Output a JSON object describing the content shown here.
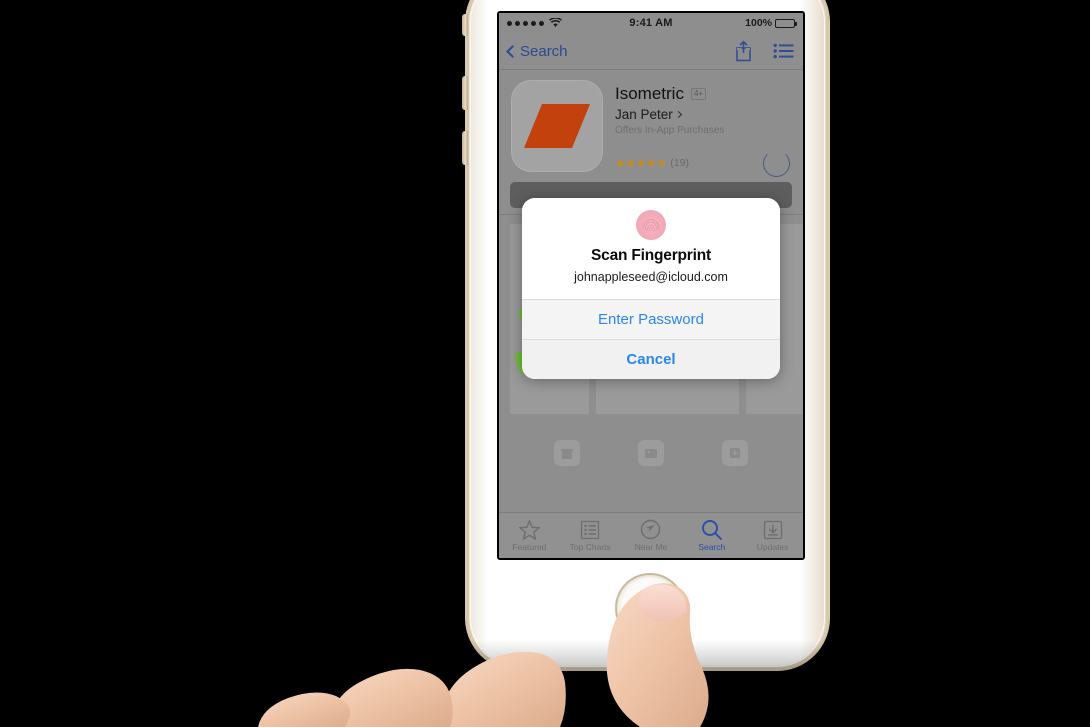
{
  "status_bar": {
    "carrier_dots": 5,
    "wifi_icon": "wifi-icon",
    "time": "9:41 AM",
    "battery_percent": "100%"
  },
  "nav_bar": {
    "back_label": "Search",
    "share_icon": "share-icon",
    "list_icon": "list-icon"
  },
  "app": {
    "icon_name": "isometric-app-icon",
    "icon_color": "#c2410c",
    "title": "Isometric",
    "age_rating": "4+",
    "developer": "Jan Peter",
    "iap_note": "Offers In-App Purchases",
    "stars": "★★★★★",
    "rating_count": "(19)",
    "buy_state_icon": "loading-spinner-icon"
  },
  "gallery": {
    "screenshot_icons": [
      "store-icon",
      "photos-icon",
      "download-icon"
    ]
  },
  "modal": {
    "icon_name": "fingerprint-icon",
    "title": "Scan Fingerprint",
    "subtitle": "johnappleseed@icloud.com",
    "enter_password_label": "Enter Password",
    "cancel_label": "Cancel",
    "accent_color": "#2b86f0"
  },
  "tab_bar": {
    "active_color": "#2b4ea8",
    "tabs": [
      {
        "label": "Featured",
        "icon": "star-icon",
        "active": false
      },
      {
        "label": "Top Charts",
        "icon": "list-icon",
        "active": false
      },
      {
        "label": "Near Me",
        "icon": "compass-icon",
        "active": false
      },
      {
        "label": "Search",
        "icon": "search-icon",
        "active": true
      },
      {
        "label": "Updates",
        "icon": "download-icon",
        "active": false
      }
    ]
  },
  "device": {
    "home_button_name": "home-button-touch-id",
    "side_buttons": [
      "silent-switch",
      "volume-up-button",
      "volume-down-button"
    ]
  }
}
